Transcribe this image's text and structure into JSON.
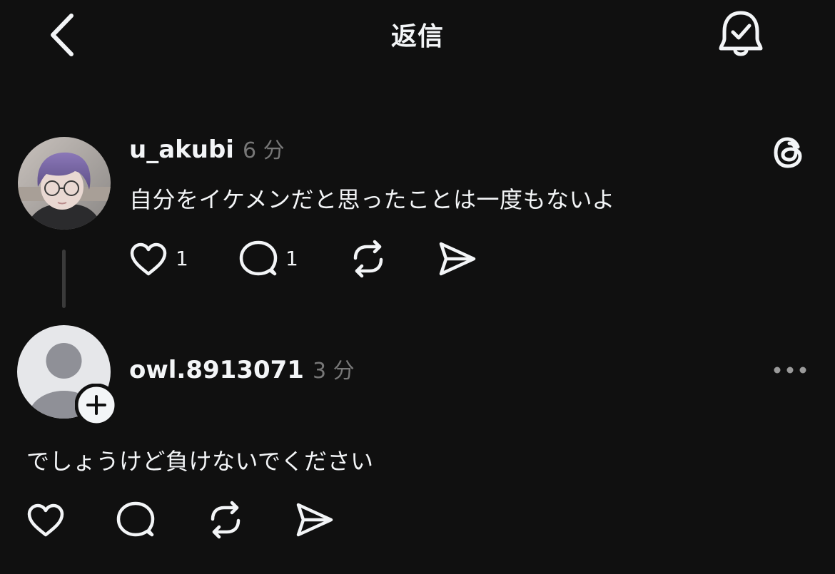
{
  "header": {
    "title": "返信",
    "back_icon": "chevron-left-icon",
    "notify_icon": "bell-check-icon"
  },
  "posts": [
    {
      "username": "u_akubi",
      "time": "6 分",
      "text": "自分をイケメンだと思ったことは一度もないよ",
      "likes": "1",
      "comments": "1",
      "avatar": "profile-photo",
      "corner_icon": "threads-logo-icon"
    },
    {
      "username": "owl.8913071",
      "time": "3 分",
      "text": "でしょうけど負けないでください",
      "avatar": "default-avatar",
      "corner_icon": "more-icon"
    }
  ],
  "colors": {
    "background": "#101010",
    "text": "#f3f5f7",
    "secondary": "#777777",
    "thread_line": "#3a3a3a"
  }
}
